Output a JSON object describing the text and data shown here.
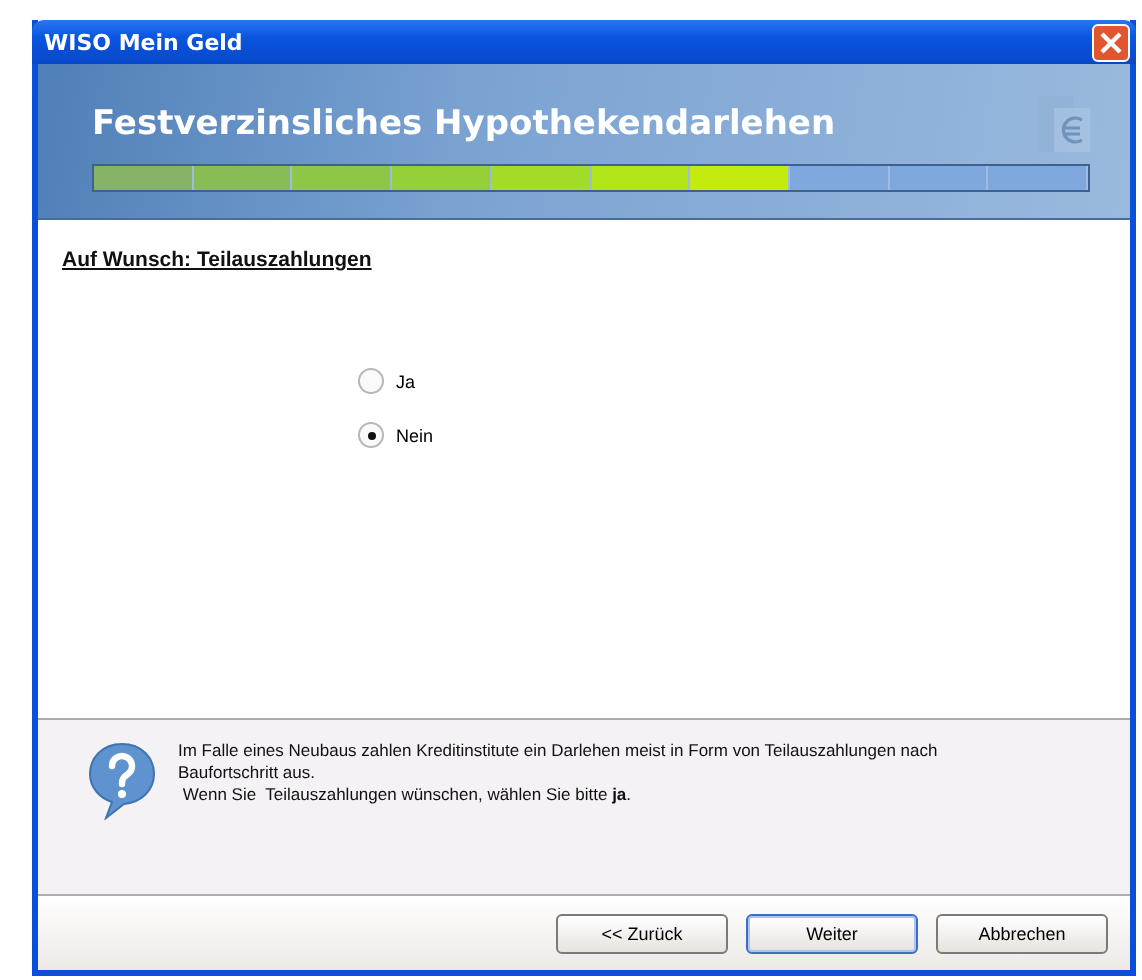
{
  "window": {
    "title": "WISO Mein Geld"
  },
  "header": {
    "title": "Festverzinsliches Hypothekendarlehen",
    "progress": {
      "level": 0.7
    }
  },
  "section": {
    "title": "Auf Wunsch: Teilauszahlungen"
  },
  "options": [
    {
      "label": "Ja",
      "selected": false
    },
    {
      "label": "Nein",
      "selected": true
    }
  ],
  "info": {
    "lines": [
      "Im Falle eines Neubaus zahlen Kreditinstitute ein Darlehen meist in Form von Teilauszahlungen nach Baufortschritt aus.",
      " Wenn Sie  Teilauszahlungen wünschen, wählen Sie bitte **ja**."
    ]
  },
  "buttons": [
    {
      "label": "<< Zurück",
      "default": false
    },
    {
      "label": "Weiter",
      "default": true
    },
    {
      "label": "Abbrechen",
      "default": false
    }
  ]
}
